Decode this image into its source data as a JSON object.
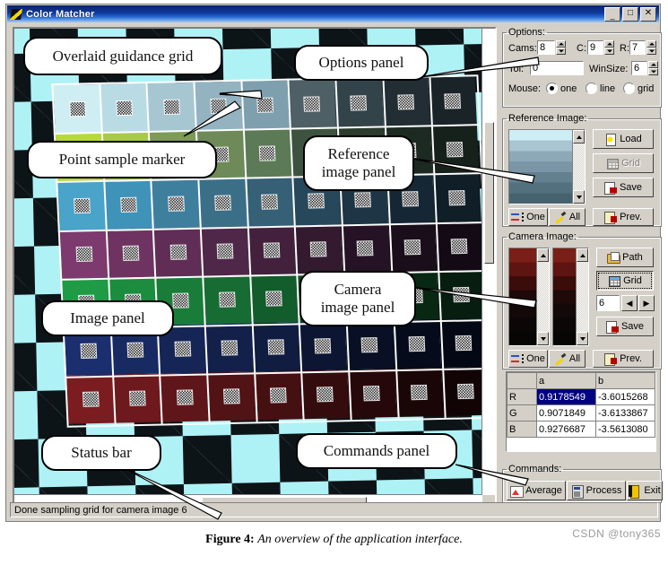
{
  "window": {
    "title": "Color Matcher",
    "buttons": {
      "minimize": "_",
      "maximize": "□",
      "close": "✕"
    }
  },
  "options": {
    "legend": "Options:",
    "cams_label": "Cams:",
    "cams_value": "8",
    "c_label": "C:",
    "c_value": "9",
    "r_label": "R:",
    "r_value": "7",
    "tol_label": "Tol:",
    "tol_value": "0",
    "winsize_label": "WinSize:",
    "winsize_value": "6",
    "mouse_label": "Mouse:",
    "mouse_options": [
      "one",
      "line",
      "grid"
    ],
    "mouse_selected": "one"
  },
  "reference_image": {
    "legend": "Reference Image:",
    "buttons": {
      "load": "Load",
      "grid": "Grid",
      "save": "Save",
      "one": "One",
      "all": "All",
      "prev": "Prev."
    },
    "grid_disabled": true,
    "swatch_colors": [
      "#cdeef5",
      "#a9c5d1",
      "#8da8b6",
      "#7a95a5",
      "#63808f",
      "#53707f",
      "#46626f"
    ]
  },
  "camera_image": {
    "legend": "Camera Image:",
    "buttons": {
      "path": "Path",
      "grid": "Grid",
      "save": "Save",
      "one": "One",
      "all": "All",
      "prev": "Prev."
    },
    "index_value": "6",
    "nav_prev": "◀",
    "nav_next": "▶",
    "swatch_colors": [
      "#7a1f18",
      "#5e1410",
      "#3a0c0a",
      "#1d0a09",
      "#120908",
      "#0c0707",
      "#080505"
    ]
  },
  "coefficients_table": {
    "columns": [
      "",
      "a",
      "b"
    ],
    "rows": [
      {
        "channel": "R",
        "a": "0.9178549",
        "b": "-3.6015268",
        "selected": true
      },
      {
        "channel": "G",
        "a": "0.9071849",
        "b": "-3.6133867",
        "selected": false
      },
      {
        "channel": "B",
        "a": "0.9276687",
        "b": "-3.5613080",
        "selected": false
      }
    ]
  },
  "commands": {
    "legend": "Commands:",
    "buttons": {
      "average": "Average",
      "process": "Process",
      "exit": "Exit"
    }
  },
  "status_bar": {
    "text": "Done sampling grid for camera image 6"
  },
  "callouts": [
    {
      "id": "overlaid-guidance-grid",
      "text": "Overlaid guidance grid"
    },
    {
      "id": "point-sample-marker",
      "text": "Point sample marker"
    },
    {
      "id": "options-panel",
      "text": "Options panel"
    },
    {
      "id": "reference-image-panel",
      "text": "Reference\nimage panel"
    },
    {
      "id": "camera-image-panel",
      "text": "Camera\nimage panel"
    },
    {
      "id": "image-panel",
      "text": "Image panel"
    },
    {
      "id": "status-bar",
      "text": "Status bar"
    },
    {
      "id": "commands-panel",
      "text": "Commands panel"
    }
  ],
  "caption": {
    "label": "Figure 4:",
    "text": "An overview of the application interface."
  },
  "watermark": {
    "text": "CSDN @tony365"
  },
  "chart_image": {
    "description": "Photographed color calibration chart over a cyan/black checkerboard",
    "rows": 7,
    "cols": 9,
    "row_colors": [
      [
        "#cfeef4",
        "#b9dbe4",
        "#a6c6d2",
        "#93b3c1",
        "#7e9fae",
        "#4e5f66",
        "#33434a",
        "#222e33",
        "#1a2328"
      ],
      [
        "#b6d93c",
        "#a8c94a",
        "#7e9a58",
        "#6d8a58",
        "#5c7a55",
        "#3d5340",
        "#2b3b2e",
        "#1d2a22",
        "#17211b"
      ],
      [
        "#4aa3c9",
        "#3f92b8",
        "#3f7f9e",
        "#3b6f88",
        "#356076",
        "#27485a",
        "#1d3544",
        "#152734",
        "#101e28"
      ],
      [
        "#7d3a6e",
        "#6f3362",
        "#5f2d55",
        "#4f2749",
        "#43213d",
        "#331a2f",
        "#251325",
        "#1a0e1b",
        "#140a15"
      ],
      [
        "#1f9a45",
        "#1c8c3f",
        "#197c38",
        "#166c32",
        "#135c2b",
        "#0f4a23",
        "#0b381a",
        "#082814",
        "#061d0f"
      ],
      [
        "#1b2f6e",
        "#182a62",
        "#152556",
        "#12204a",
        "#101c40",
        "#0c1531",
        "#091025",
        "#060b1b",
        "#040814"
      ],
      [
        "#7a1c20",
        "#6d191d",
        "#5f161a",
        "#511316",
        "#451012",
        "#350c0e",
        "#26080a",
        "#1a0607",
        "#120405"
      ]
    ]
  }
}
